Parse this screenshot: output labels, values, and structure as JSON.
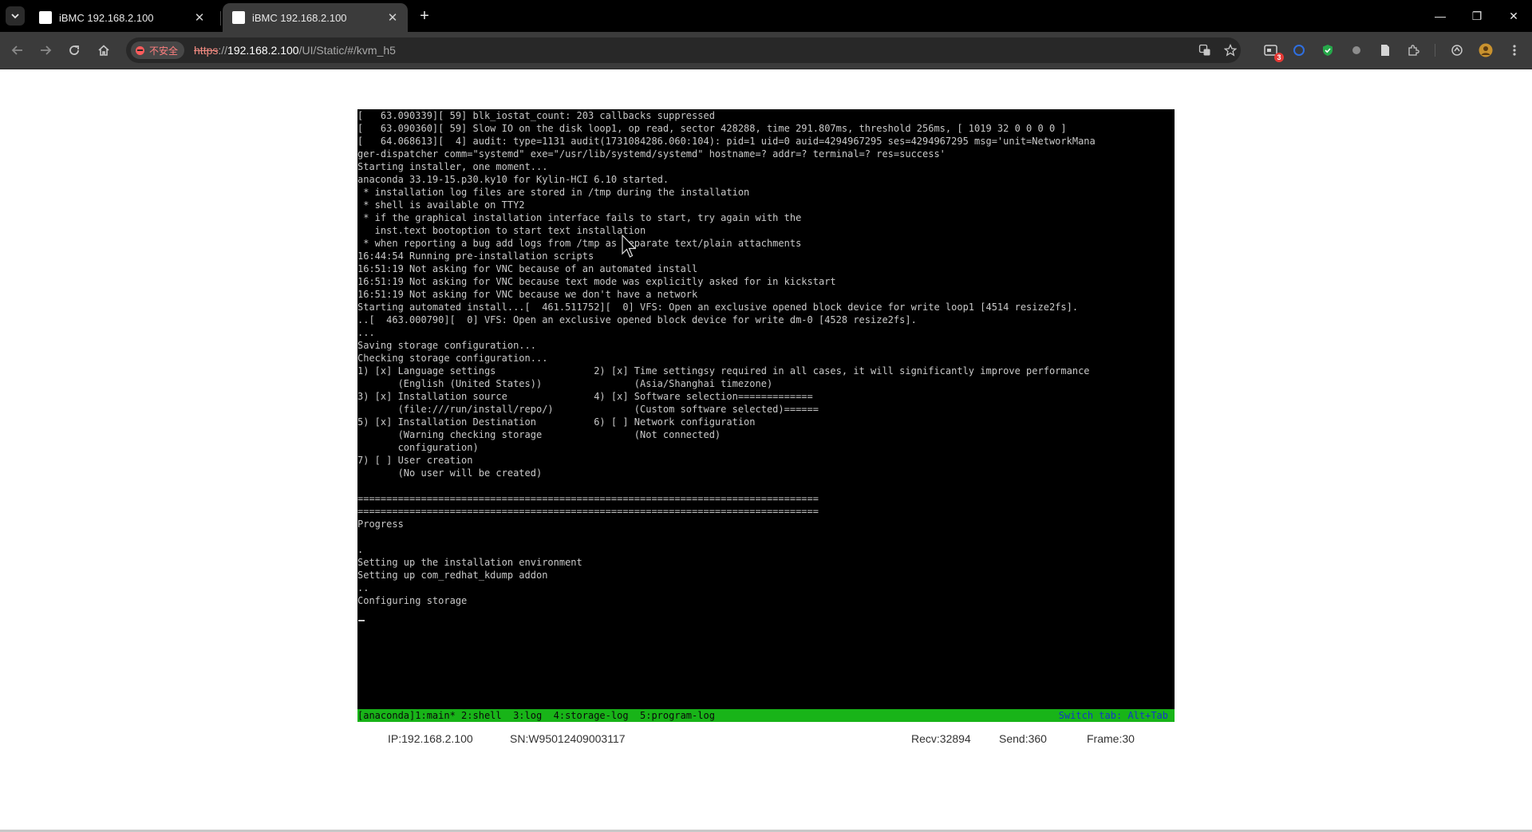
{
  "browser": {
    "tabs": [
      {
        "title": "iBMC 192.168.2.100",
        "close": "✕",
        "active": false
      },
      {
        "title": "iBMC 192.168.2.100",
        "close": "✕",
        "active": true
      }
    ],
    "new_tab": "+",
    "window_controls": {
      "minimize": "—",
      "restore": "❐",
      "close": "✕"
    },
    "address": {
      "security_label": "不安全",
      "url_scheme": "https",
      "url_sep": "://",
      "url_host": "192.168.2.100",
      "url_path": "/UI/Static/#/kvm_h5"
    },
    "extension_badge": "3"
  },
  "console": {
    "lines": [
      "[   63.090339][ 59] blk_iostat_count: 203 callbacks suppressed",
      "[   63.090360][ 59] Slow IO on the disk loop1, op read, sector 428288, time 291.807ms, threshold 256ms, [ 1019 32 0 0 0 0 ]",
      "[   64.068613][  4] audit: type=1131 audit(1731084286.060:104): pid=1 uid=0 auid=4294967295 ses=4294967295 msg='unit=NetworkMana",
      "ger-dispatcher comm=\"systemd\" exe=\"/usr/lib/systemd/systemd\" hostname=? addr=? terminal=? res=success'",
      "Starting installer, one moment...",
      "anaconda 33.19-15.p30.ky10 for Kylin-HCI 6.10 started.",
      " * installation log files are stored in /tmp during the installation",
      " * shell is available on TTY2",
      " * if the graphical installation interface fails to start, try again with the",
      "   inst.text bootoption to start text installation",
      " * when reporting a bug add logs from /tmp as separate text/plain attachments",
      "16:44:54 Running pre-installation scripts",
      "16:51:19 Not asking for VNC because of an automated install",
      "16:51:19 Not asking for VNC because text mode was explicitly asked for in kickstart",
      "16:51:19 Not asking for VNC because we don't have a network",
      "Starting automated install...[  461.511752][  0] VFS: Open an exclusive opened block device for write loop1 [4514 resize2fs].",
      "..[  463.000790][  0] VFS: Open an exclusive opened block device for write dm-0 [4528 resize2fs].",
      "...",
      "Saving storage configuration...",
      "Checking storage configuration...",
      "1) [x] Language settings                 2) [x] Time settingsy required in all cases, it will significantly improve performance",
      "       (English (United States))                (Asia/Shanghai timezone)",
      "3) [x] Installation source               4) [x] Software selection=============",
      "       (file:///run/install/repo/)              (Custom software selected)======",
      "5) [x] Installation Destination          6) [ ] Network configuration",
      "       (Warning checking storage                (Not connected)",
      "       configuration)",
      "7) [ ] User creation",
      "       (No user will be created)",
      "",
      "================================================================================",
      "================================================================================",
      "Progress",
      "",
      ".",
      "Setting up the installation environment",
      "Setting up com_redhat_kdump addon",
      "..",
      "Configuring storage"
    ],
    "status_bar_left": "[anaconda]1:main* 2:shell  3:log  4:storage-log  5:program-log",
    "status_bar_right": "Switch tab: Alt+Tab"
  },
  "kvm_footer": {
    "ip": "IP:192.168.2.100",
    "sn": "SN:W95012409003117",
    "recv": "Recv:32894",
    "send": "Send:360",
    "frame": "Frame:30"
  },
  "icons": {
    "tab_search": "chevron-down-icon",
    "favicon": "page-icon",
    "back": "back-arrow-icon",
    "forward": "forward-arrow-icon",
    "reload": "reload-icon",
    "home": "home-icon",
    "translate": "translate-icon",
    "bookmark": "star-icon",
    "menu": "kebab-menu-icon"
  },
  "colors": {
    "console_bg": "#000000",
    "console_text": "#c9c9c9",
    "status_bar_green": "#18b418",
    "status_bar_blue_text": "#1437c8",
    "insecure_red": "#ff5b5b"
  }
}
